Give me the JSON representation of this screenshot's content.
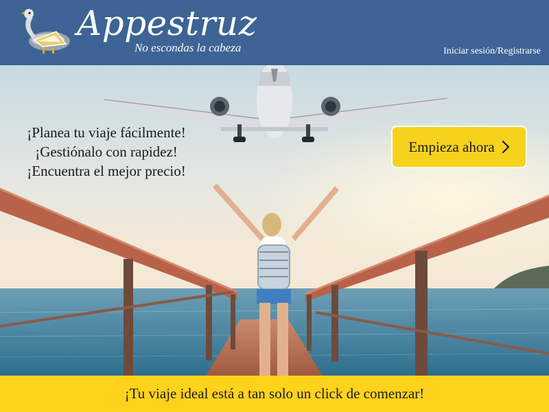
{
  "header": {
    "brand_name": "Appestruz",
    "tagline": "No escondas la cabeza",
    "login_label": "Iniciar sesión/Registrarse",
    "logo_icon": "ostrich-logo-icon",
    "background_color": "#3d6494"
  },
  "hero": {
    "lines": [
      "¡Planea tu viaje fácilmente!",
      "¡Gestiónalo con rapidez!",
      "¡Encuentra el mejor precio!"
    ],
    "cta_label": "Empieza ahora",
    "cta_icon": "chevron-right-icon",
    "cta_color": "#f7d21c"
  },
  "footer": {
    "text": "¡Tu viaje ideal está a tan solo un click de comenzar!",
    "background_color": "#ffd21c"
  }
}
